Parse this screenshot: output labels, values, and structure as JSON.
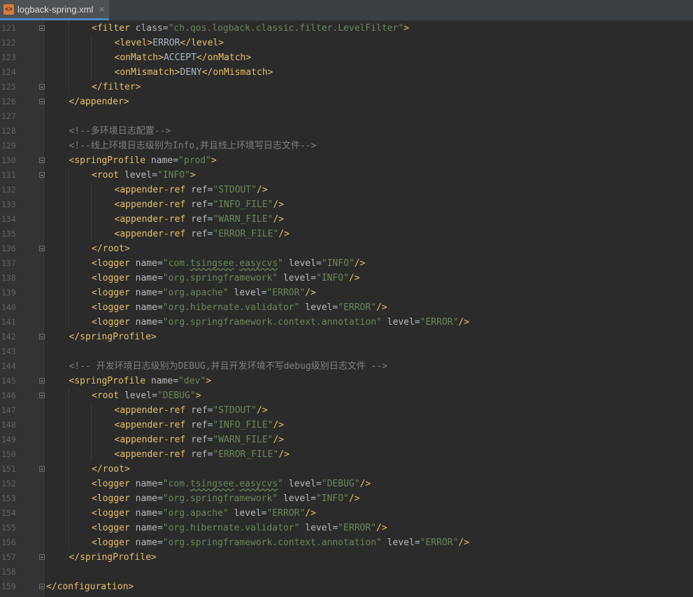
{
  "tab": {
    "filename": "logback-spring.xml",
    "close_glyph": "×",
    "icon": "xml-file-icon"
  },
  "lines": [
    {
      "num": "121",
      "indent": 2,
      "fold": true,
      "tokens": [
        [
          "tag",
          "<filter "
        ],
        [
          "attr",
          "class"
        ],
        [
          "txt",
          "="
        ],
        [
          "val",
          "\"ch.qos.logback.classic.filter.LevelFilter\""
        ],
        [
          "tag",
          ">"
        ]
      ]
    },
    {
      "num": "122",
      "indent": 3,
      "tokens": [
        [
          "tag",
          "<level>"
        ],
        [
          "txt",
          "ERROR"
        ],
        [
          "tag",
          "</level>"
        ]
      ]
    },
    {
      "num": "123",
      "indent": 3,
      "tokens": [
        [
          "tag",
          "<onMatch>"
        ],
        [
          "txt",
          "ACCEPT"
        ],
        [
          "tag",
          "</onMatch>"
        ]
      ]
    },
    {
      "num": "124",
      "indent": 3,
      "tokens": [
        [
          "tag",
          "<onMismatch>"
        ],
        [
          "txt",
          "DENY"
        ],
        [
          "tag",
          "</onMismatch>"
        ]
      ]
    },
    {
      "num": "125",
      "indent": 2,
      "fold": true,
      "tokens": [
        [
          "tag",
          "</filter>"
        ]
      ]
    },
    {
      "num": "126",
      "indent": 1,
      "fold": true,
      "tokens": [
        [
          "tag",
          "</appender>"
        ]
      ]
    },
    {
      "num": "127",
      "indent": 0,
      "tokens": []
    },
    {
      "num": "128",
      "indent": 1,
      "tokens": [
        [
          "cmt",
          "<!--多环境日志配置-->"
        ]
      ]
    },
    {
      "num": "129",
      "indent": 1,
      "tokens": [
        [
          "cmt",
          "<!--线上环境日志级别为Info,并且线上环境写日志文件-->"
        ]
      ]
    },
    {
      "num": "130",
      "indent": 1,
      "fold": true,
      "tokens": [
        [
          "tag",
          "<springProfile "
        ],
        [
          "attr",
          "name"
        ],
        [
          "txt",
          "="
        ],
        [
          "val",
          "\"prod\""
        ],
        [
          "tag",
          ">"
        ]
      ]
    },
    {
      "num": "131",
      "indent": 2,
      "fold": true,
      "tokens": [
        [
          "tag",
          "<root "
        ],
        [
          "attr",
          "level"
        ],
        [
          "txt",
          "="
        ],
        [
          "val",
          "\"INFO\""
        ],
        [
          "tag",
          ">"
        ]
      ]
    },
    {
      "num": "132",
      "indent": 3,
      "tokens": [
        [
          "tag",
          "<appender-ref "
        ],
        [
          "attr",
          "ref"
        ],
        [
          "txt",
          "="
        ],
        [
          "val",
          "\"STDOUT\""
        ],
        [
          "tag",
          "/>"
        ]
      ]
    },
    {
      "num": "133",
      "indent": 3,
      "tokens": [
        [
          "tag",
          "<appender-ref "
        ],
        [
          "attr",
          "ref"
        ],
        [
          "txt",
          "="
        ],
        [
          "val",
          "\"INFO_FILE\""
        ],
        [
          "tag",
          "/>"
        ]
      ]
    },
    {
      "num": "134",
      "indent": 3,
      "tokens": [
        [
          "tag",
          "<appender-ref "
        ],
        [
          "attr",
          "ref"
        ],
        [
          "txt",
          "="
        ],
        [
          "val",
          "\"WARN_FILE\""
        ],
        [
          "tag",
          "/>"
        ]
      ]
    },
    {
      "num": "135",
      "indent": 3,
      "tokens": [
        [
          "tag",
          "<appender-ref "
        ],
        [
          "attr",
          "ref"
        ],
        [
          "txt",
          "="
        ],
        [
          "val",
          "\"ERROR_FILE\""
        ],
        [
          "tag",
          "/>"
        ]
      ]
    },
    {
      "num": "136",
      "indent": 2,
      "fold": true,
      "tokens": [
        [
          "tag",
          "</root>"
        ]
      ]
    },
    {
      "num": "137",
      "indent": 2,
      "tokens": [
        [
          "tag",
          "<logger "
        ],
        [
          "attr",
          "name"
        ],
        [
          "txt",
          "="
        ],
        [
          "val",
          "\"com."
        ],
        [
          "valtypo",
          "tsingsee"
        ],
        [
          "val",
          "."
        ],
        [
          "valtypo",
          "easycvs"
        ],
        [
          "val",
          "\""
        ],
        [
          "txt",
          " "
        ],
        [
          "attr",
          "level"
        ],
        [
          "txt",
          "="
        ],
        [
          "val",
          "\"INFO\""
        ],
        [
          "tag",
          "/>"
        ]
      ]
    },
    {
      "num": "138",
      "indent": 2,
      "tokens": [
        [
          "tag",
          "<logger "
        ],
        [
          "attr",
          "name"
        ],
        [
          "txt",
          "="
        ],
        [
          "val",
          "\"org.springframework\""
        ],
        [
          "txt",
          " "
        ],
        [
          "attr",
          "level"
        ],
        [
          "txt",
          "="
        ],
        [
          "val",
          "\"INFO\""
        ],
        [
          "tag",
          "/>"
        ]
      ]
    },
    {
      "num": "139",
      "indent": 2,
      "tokens": [
        [
          "tag",
          "<logger "
        ],
        [
          "attr",
          "name"
        ],
        [
          "txt",
          "="
        ],
        [
          "val",
          "\"org.apache\""
        ],
        [
          "txt",
          " "
        ],
        [
          "attr",
          "level"
        ],
        [
          "txt",
          "="
        ],
        [
          "val",
          "\"ERROR\""
        ],
        [
          "tag",
          "/>"
        ]
      ]
    },
    {
      "num": "140",
      "indent": 2,
      "tokens": [
        [
          "tag",
          "<logger "
        ],
        [
          "attr",
          "name"
        ],
        [
          "txt",
          "="
        ],
        [
          "val",
          "\"org.hibernate.validator\""
        ],
        [
          "txt",
          " "
        ],
        [
          "attr",
          "level"
        ],
        [
          "txt",
          "="
        ],
        [
          "val",
          "\"ERROR\""
        ],
        [
          "tag",
          "/>"
        ]
      ]
    },
    {
      "num": "141",
      "indent": 2,
      "tokens": [
        [
          "tag",
          "<logger "
        ],
        [
          "attr",
          "name"
        ],
        [
          "txt",
          "="
        ],
        [
          "val",
          "\"org.springframework.context.annotation\""
        ],
        [
          "txt",
          " "
        ],
        [
          "attr",
          "level"
        ],
        [
          "txt",
          "="
        ],
        [
          "val",
          "\"ERROR\""
        ],
        [
          "tag",
          "/>"
        ]
      ]
    },
    {
      "num": "142",
      "indent": 1,
      "fold": true,
      "tokens": [
        [
          "tag",
          "</springProfile>"
        ]
      ]
    },
    {
      "num": "143",
      "indent": 0,
      "tokens": []
    },
    {
      "num": "144",
      "indent": 1,
      "tokens": [
        [
          "cmt",
          "<!-- 开发环境日志级别为DEBUG,并且开发环境不写debug级别日志文件 -->"
        ]
      ]
    },
    {
      "num": "145",
      "indent": 1,
      "fold": true,
      "tokens": [
        [
          "tag",
          "<springProfile "
        ],
        [
          "attr",
          "name"
        ],
        [
          "txt",
          "="
        ],
        [
          "val",
          "\"dev\""
        ],
        [
          "tag",
          ">"
        ]
      ]
    },
    {
      "num": "146",
      "indent": 2,
      "fold": true,
      "tokens": [
        [
          "tag",
          "<root "
        ],
        [
          "attr",
          "level"
        ],
        [
          "txt",
          "="
        ],
        [
          "val",
          "\"DEBUG\""
        ],
        [
          "tag",
          ">"
        ]
      ]
    },
    {
      "num": "147",
      "indent": 3,
      "tokens": [
        [
          "tag",
          "<appender-ref "
        ],
        [
          "attr",
          "ref"
        ],
        [
          "txt",
          "="
        ],
        [
          "val",
          "\"STDOUT\""
        ],
        [
          "tag",
          "/>"
        ]
      ]
    },
    {
      "num": "148",
      "indent": 3,
      "tokens": [
        [
          "tag",
          "<appender-ref "
        ],
        [
          "attr",
          "ref"
        ],
        [
          "txt",
          "="
        ],
        [
          "val",
          "\"INFO_FILE\""
        ],
        [
          "tag",
          "/>"
        ]
      ]
    },
    {
      "num": "149",
      "indent": 3,
      "tokens": [
        [
          "tag",
          "<appender-ref "
        ],
        [
          "attr",
          "ref"
        ],
        [
          "txt",
          "="
        ],
        [
          "val",
          "\"WARN_FILE\""
        ],
        [
          "tag",
          "/>"
        ]
      ]
    },
    {
      "num": "150",
      "indent": 3,
      "tokens": [
        [
          "tag",
          "<appender-ref "
        ],
        [
          "attr",
          "ref"
        ],
        [
          "txt",
          "="
        ],
        [
          "val",
          "\"ERROR_FILE\""
        ],
        [
          "tag",
          "/>"
        ]
      ]
    },
    {
      "num": "151",
      "indent": 2,
      "fold": true,
      "tokens": [
        [
          "tag",
          "</root>"
        ]
      ]
    },
    {
      "num": "152",
      "indent": 2,
      "tokens": [
        [
          "tag",
          "<logger "
        ],
        [
          "attr",
          "name"
        ],
        [
          "txt",
          "="
        ],
        [
          "val",
          "\"com."
        ],
        [
          "valtypo",
          "tsingsee"
        ],
        [
          "val",
          "."
        ],
        [
          "valtypo",
          "easycvs"
        ],
        [
          "val",
          "\""
        ],
        [
          "txt",
          " "
        ],
        [
          "attr",
          "level"
        ],
        [
          "txt",
          "="
        ],
        [
          "val",
          "\"DEBUG\""
        ],
        [
          "tag",
          "/>"
        ]
      ]
    },
    {
      "num": "153",
      "indent": 2,
      "tokens": [
        [
          "tag",
          "<logger "
        ],
        [
          "attr",
          "name"
        ],
        [
          "txt",
          "="
        ],
        [
          "val",
          "\"org.springframework\""
        ],
        [
          "txt",
          " "
        ],
        [
          "attr",
          "level"
        ],
        [
          "txt",
          "="
        ],
        [
          "val",
          "\"INFO\""
        ],
        [
          "tag",
          "/>"
        ]
      ]
    },
    {
      "num": "154",
      "indent": 2,
      "tokens": [
        [
          "tag",
          "<logger "
        ],
        [
          "attr",
          "name"
        ],
        [
          "txt",
          "="
        ],
        [
          "val",
          "\"org.apache\""
        ],
        [
          "txt",
          " "
        ],
        [
          "attr",
          "level"
        ],
        [
          "txt",
          "="
        ],
        [
          "val",
          "\"ERROR\""
        ],
        [
          "tag",
          "/>"
        ]
      ]
    },
    {
      "num": "155",
      "indent": 2,
      "tokens": [
        [
          "tag",
          "<logger "
        ],
        [
          "attr",
          "name"
        ],
        [
          "txt",
          "="
        ],
        [
          "val",
          "\"org.hibernate.validator\""
        ],
        [
          "txt",
          " "
        ],
        [
          "attr",
          "level"
        ],
        [
          "txt",
          "="
        ],
        [
          "val",
          "\"ERROR\""
        ],
        [
          "tag",
          "/>"
        ]
      ]
    },
    {
      "num": "156",
      "indent": 2,
      "tokens": [
        [
          "tag",
          "<logger "
        ],
        [
          "attr",
          "name"
        ],
        [
          "txt",
          "="
        ],
        [
          "val",
          "\"org.springframework.context.annotation\""
        ],
        [
          "txt",
          " "
        ],
        [
          "attr",
          "level"
        ],
        [
          "txt",
          "="
        ],
        [
          "val",
          "\"ERROR\""
        ],
        [
          "tag",
          "/>"
        ]
      ]
    },
    {
      "num": "157",
      "indent": 1,
      "fold": true,
      "tokens": [
        [
          "tag",
          "</springProfile>"
        ]
      ]
    },
    {
      "num": "158",
      "indent": 0,
      "tokens": []
    },
    {
      "num": "159",
      "indent": 0,
      "fold": true,
      "tokens": [
        [
          "tag",
          "</configuration>"
        ]
      ]
    }
  ]
}
